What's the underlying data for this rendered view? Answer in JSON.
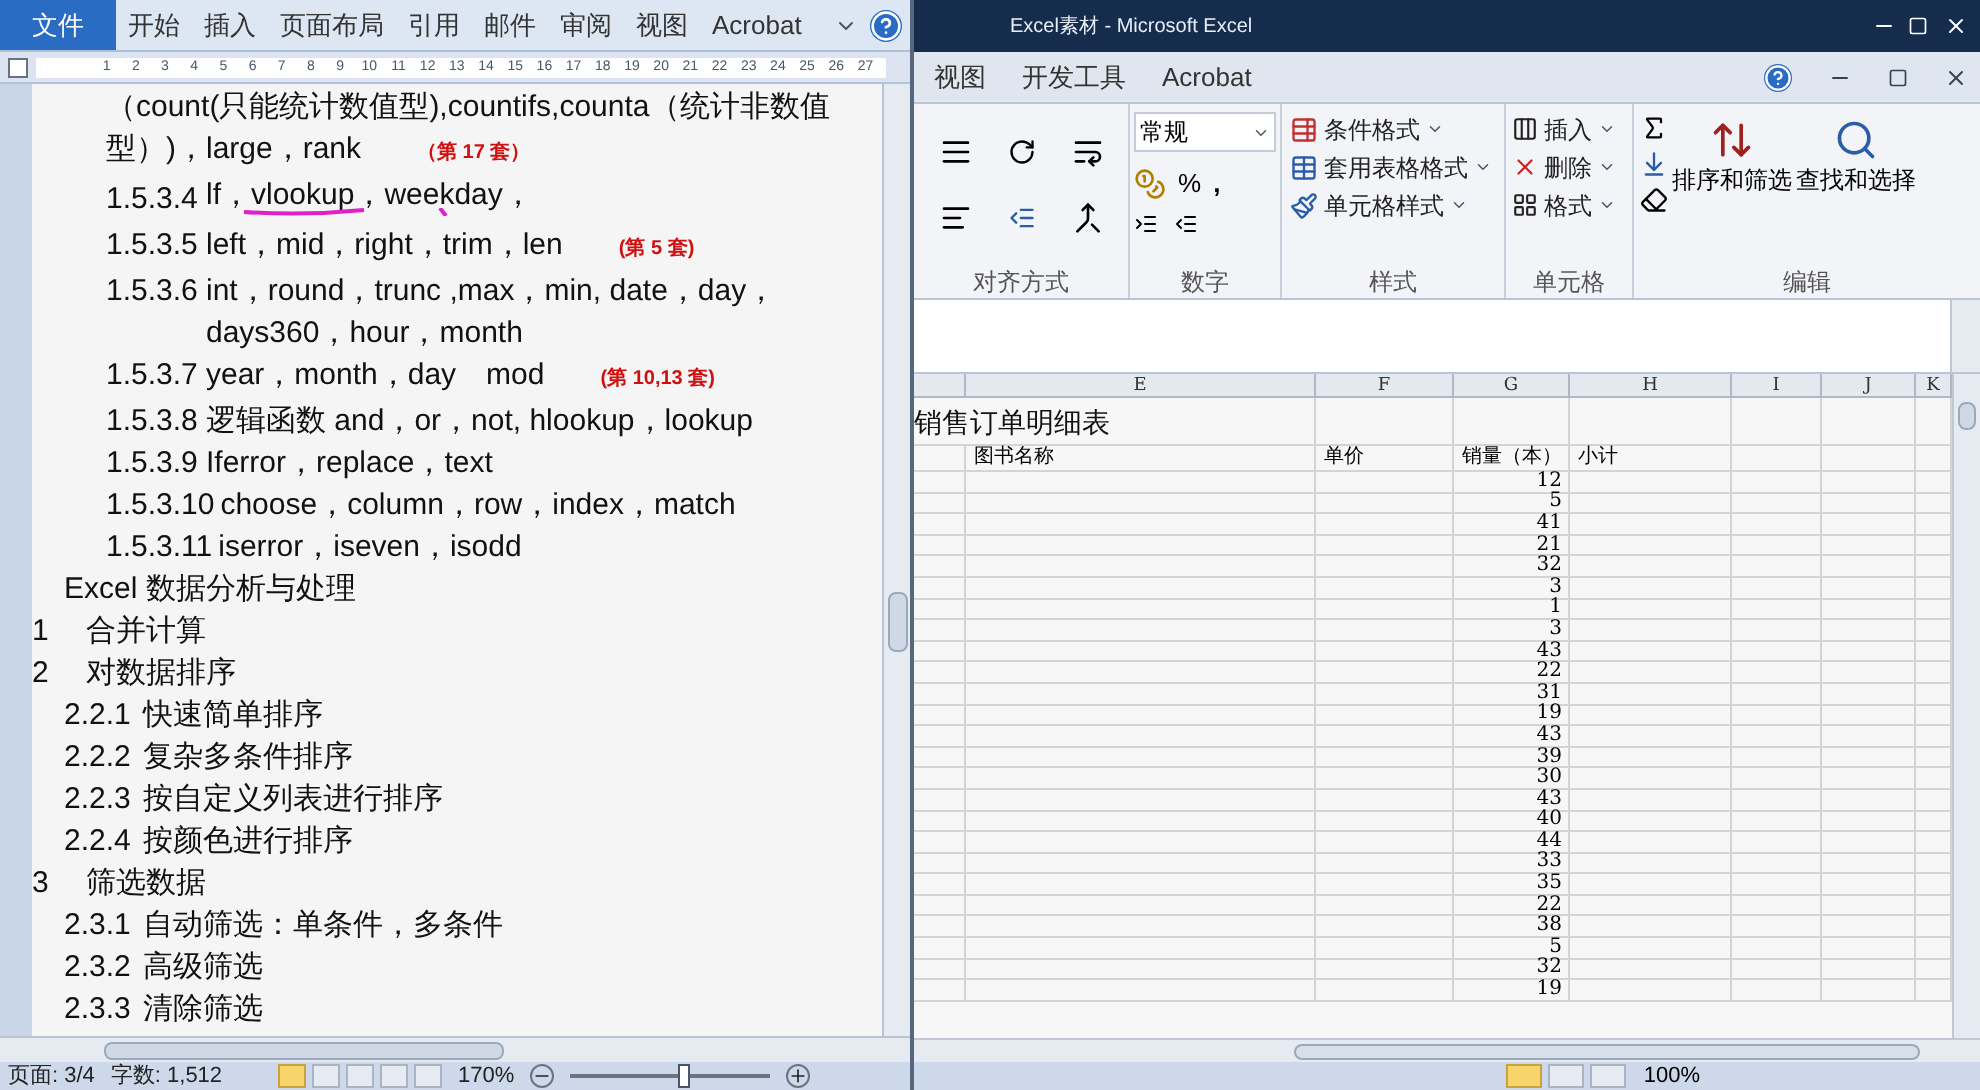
{
  "word": {
    "tabs": [
      {
        "label": "文件",
        "selected": true
      },
      {
        "label": "开始",
        "selected": false
      },
      {
        "label": "插入",
        "selected": false
      },
      {
        "label": "页面布局",
        "selected": false
      },
      {
        "label": "引用",
        "selected": false
      },
      {
        "label": "邮件",
        "selected": false
      },
      {
        "label": "审阅",
        "selected": false
      },
      {
        "label": "视图",
        "selected": false
      },
      {
        "label": "Acrobat",
        "selected": false
      }
    ],
    "ruler_marks": [
      "1",
      "2",
      "3",
      "4",
      "5",
      "6",
      "7",
      "8",
      "9",
      "10",
      "11",
      "12",
      "13",
      "14",
      "15",
      "16",
      "17",
      "18",
      "19",
      "20",
      "21",
      "22",
      "23",
      "24",
      "25",
      "26",
      "27"
    ],
    "lines": [
      {
        "kind": "item",
        "text": "（count(只能统计数值型),countifs,counta（统计非数值型）)，large，rank",
        "note": "（第 17 套）",
        "annotated": false
      },
      {
        "kind": "item",
        "number": "1.5.3.4",
        "text": "lf，vlookup，weekday，",
        "annotated": true
      },
      {
        "kind": "item",
        "number": "1.5.3.5",
        "text": "left，mid，right，trim，len",
        "note": "(第 5 套)",
        "annotated": false
      },
      {
        "kind": "item",
        "number": "1.5.3.6",
        "text": "int，round，trunc ,max，min, date，day，days360，hour，month",
        "annotated": false
      },
      {
        "kind": "item",
        "number": "1.5.3.7",
        "text": "year，month，day　mod",
        "note": "(第 10,13 套)",
        "annotated": false
      },
      {
        "kind": "item",
        "number": "1.5.3.8",
        "text": "逻辑函数 and，or，not, hlookup，lookup",
        "annotated": false
      },
      {
        "kind": "item",
        "number": "1.5.3.9",
        "text": "Iferror，replace，text",
        "annotated": false
      },
      {
        "kind": "item",
        "number": "1.5.3.10",
        "text": "choose，column，row，index，match",
        "annotated": false
      },
      {
        "kind": "item",
        "number": "1.5.3.11",
        "text": "iserror，iseven，isodd",
        "annotated": false
      },
      {
        "kind": "section",
        "text": "Excel 数据分析与处理",
        "annotated": false
      },
      {
        "kind": "chapter",
        "number": "1",
        "text": "合并计算",
        "annotated": false
      },
      {
        "kind": "chapter",
        "number": "2",
        "text": "对数据排序",
        "annotated": false
      },
      {
        "kind": "section",
        "number": "2.2.1",
        "text": "快速简单排序",
        "annotated": false
      },
      {
        "kind": "section",
        "number": "2.2.2",
        "text": "复杂多条件排序",
        "annotated": false
      },
      {
        "kind": "section",
        "number": "2.2.3",
        "text": "按自定义列表进行排序",
        "annotated": false
      },
      {
        "kind": "section",
        "number": "2.2.4",
        "text": "按颜色进行排序",
        "annotated": false
      },
      {
        "kind": "chapter",
        "number": "3",
        "text": "筛选数据",
        "annotated": false
      },
      {
        "kind": "section",
        "number": "2.3.1",
        "text": "自动筛选：单条件，多条件",
        "annotated": false
      },
      {
        "kind": "section",
        "number": "2.3.2",
        "text": "高级筛选",
        "annotated": false
      },
      {
        "kind": "section",
        "number": "2.3.3",
        "text": "清除筛选",
        "annotated": false
      }
    ],
    "status": {
      "page": "页面: 3/4",
      "words": "字数: 1,512",
      "zoom": "170%"
    },
    "view_buttons": [
      {
        "selected": true
      },
      {
        "selected": false
      },
      {
        "selected": false
      },
      {
        "selected": false
      },
      {
        "selected": false
      }
    ],
    "zoom_slider": {
      "level": 0.57
    }
  },
  "excel": {
    "title": "Excel素材 - Microsoft Excel",
    "tabs": [
      "视图",
      "开发工具",
      "Acrobat"
    ],
    "ribbon": {
      "number_format": "常规",
      "number_symbols": [
        "%",
        ","
      ],
      "style_buttons": [
        "条件格式",
        "套用表格格式",
        "单元格样式"
      ],
      "cell_buttons": [
        "插入",
        "删除",
        "格式"
      ],
      "edit_buttons": [
        "排序和筛选",
        "查找和选择"
      ],
      "groups": [
        "对齐方式",
        "数字",
        "样式",
        "单元格",
        "编辑"
      ]
    },
    "columns": [
      "E",
      "F",
      "G",
      "H",
      "I",
      "J",
      "K"
    ],
    "sheet_title": "销售订单明细表",
    "headers": [
      "图书名称",
      "单价",
      "销量（本）",
      "小计"
    ],
    "sales": [
      "12",
      "5",
      "41",
      "21",
      "32",
      "3",
      "1",
      "3",
      "43",
      "22",
      "31",
      "19",
      "43",
      "39",
      "30",
      "43",
      "40",
      "44",
      "33",
      "35",
      "22",
      "38",
      "5",
      "32",
      "19"
    ],
    "zoom": "100%",
    "view_buttons": [
      {
        "selected": true
      },
      {
        "selected": false
      },
      {
        "selected": false
      }
    ]
  }
}
